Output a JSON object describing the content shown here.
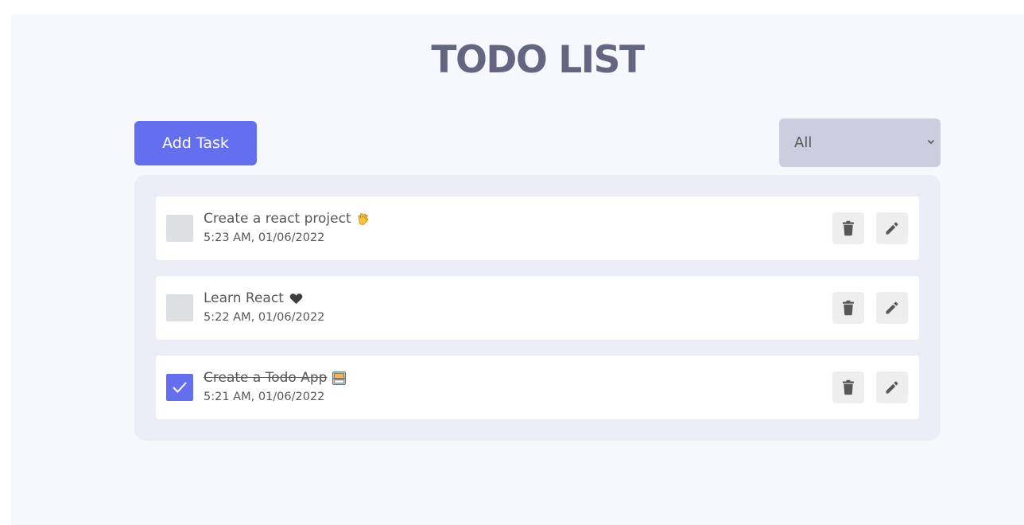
{
  "header": {
    "title": "TODO LIST"
  },
  "toolbar": {
    "add_label": "Add Task",
    "filter": {
      "selected": "All"
    }
  },
  "colors": {
    "accent": "#646ff0",
    "title": "#646681",
    "filter_bg": "#cccdde",
    "list_bg": "#ecedf6"
  },
  "todos": [
    {
      "title": "Create a react project",
      "time": "5:23 AM, 01/06/2022",
      "completed": false,
      "emoji": "vulcan-salute-icon"
    },
    {
      "title": "Learn React",
      "time": "5:22 AM, 01/06/2022",
      "completed": false,
      "emoji": "heart-icon"
    },
    {
      "title": "Create a Todo App",
      "time": "5:21 AM, 01/06/2022",
      "completed": true,
      "emoji": "computer-icon"
    }
  ]
}
